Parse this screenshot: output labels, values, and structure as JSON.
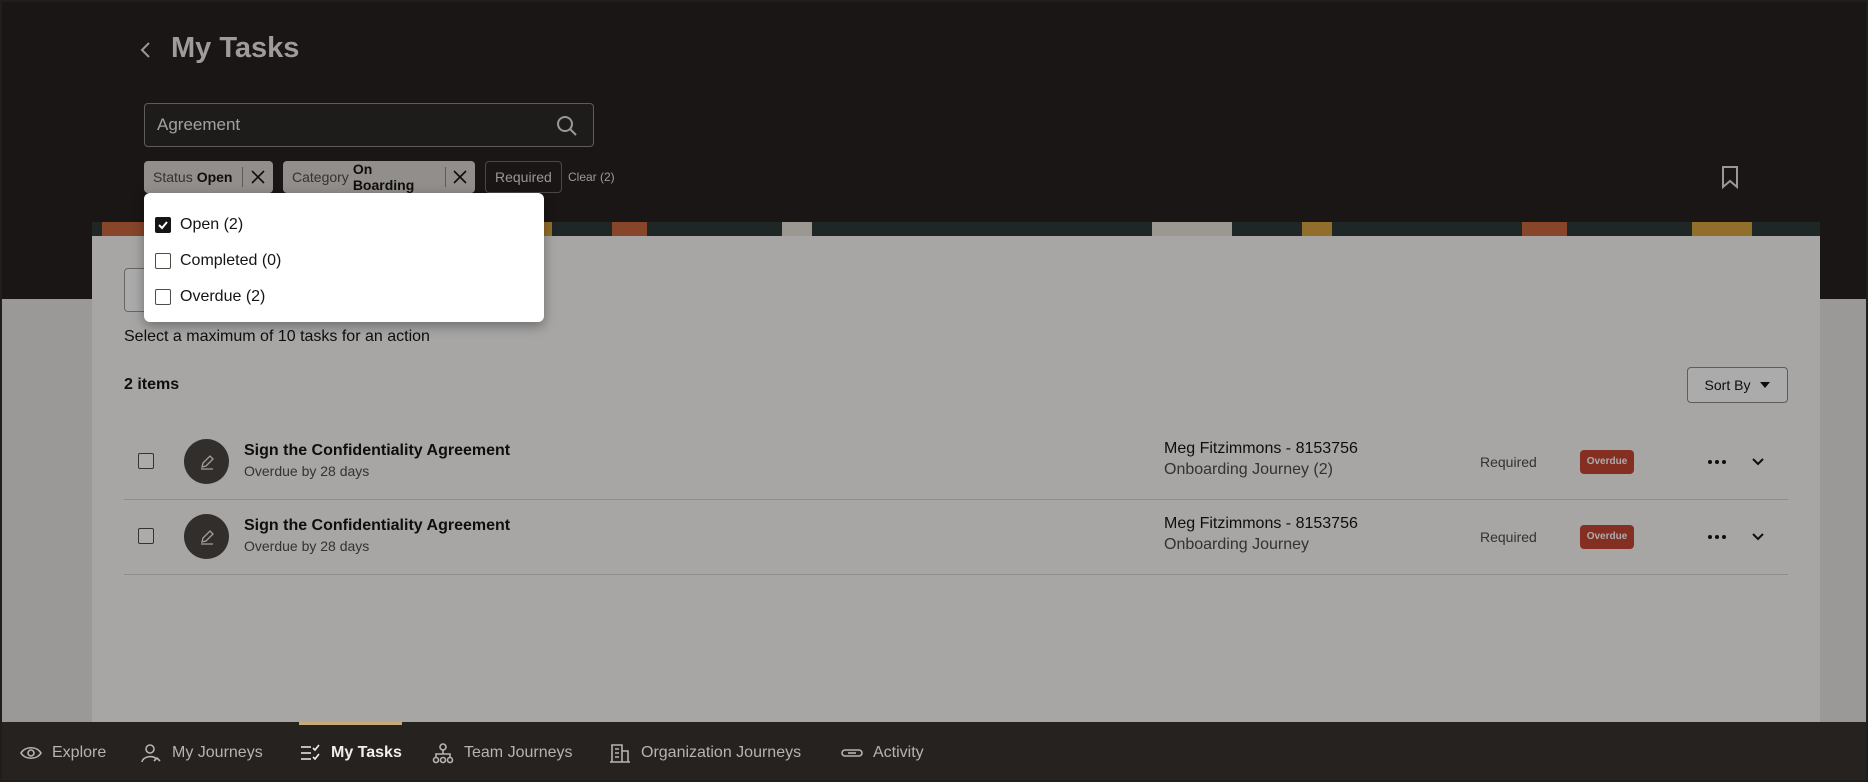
{
  "header": {
    "title": "My Tasks",
    "search_value": "Agreement",
    "search_placeholder": "Search"
  },
  "filters": {
    "chips": [
      {
        "label": "Status",
        "value": "Open"
      },
      {
        "label": "Category",
        "value": "On Boarding"
      }
    ],
    "required_label": "Required",
    "clear_label": "Clear (2)"
  },
  "status_dropdown": {
    "options": [
      {
        "label": "Open (2)",
        "checked": true
      },
      {
        "label": "Completed (0)",
        "checked": false
      },
      {
        "label": "Overdue (2)",
        "checked": false
      }
    ]
  },
  "list": {
    "info": "Select a maximum of 10 tasks for an action",
    "count": "2 items",
    "sort_label": "Sort By",
    "rows": [
      {
        "title": "Sign the Confidentiality Agreement",
        "subtitle": "Overdue by 28 days",
        "owner": "Meg Fitzimmons - 8153756",
        "journey": "Onboarding Journey (2)",
        "requirement": "Required",
        "badge": "Overdue"
      },
      {
        "title": "Sign the Confidentiality Agreement",
        "subtitle": "Overdue by 28 days",
        "owner": "Meg Fitzimmons - 8153756",
        "journey": "Onboarding Journey",
        "requirement": "Required",
        "badge": "Overdue"
      }
    ]
  },
  "bottom_nav": {
    "items": [
      {
        "label": "Explore",
        "icon": "eye-icon"
      },
      {
        "label": "My Journeys",
        "icon": "person-icon"
      },
      {
        "label": "My Tasks",
        "icon": "checklist-icon",
        "active": true
      },
      {
        "label": "Team Journeys",
        "icon": "hierarchy-icon"
      },
      {
        "label": "Organization Journeys",
        "icon": "building-icon"
      },
      {
        "label": "Activity",
        "icon": "link-icon"
      }
    ]
  },
  "colors": {
    "header_bg": "#262220",
    "overdue_badge": "#c74634",
    "active_nav_accent": "#c9a978"
  }
}
